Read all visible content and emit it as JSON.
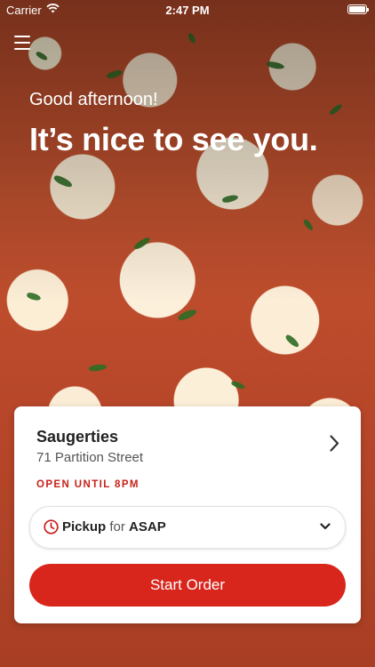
{
  "status_bar": {
    "carrier": "Carrier",
    "time": "2:47 PM"
  },
  "header": {
    "greeting": "Good afternoon!",
    "headline": "It’s nice to see you."
  },
  "location": {
    "name": "Saugerties",
    "address": "71 Partition Street",
    "hours_status": "OPEN UNTIL 8PM"
  },
  "order": {
    "method": "Pickup",
    "connector": "for",
    "time": "ASAP",
    "start_label": "Start Order"
  },
  "colors": {
    "accent": "#d9261c",
    "status_red": "#c8211a"
  },
  "icons": [
    "wifi-icon",
    "battery-icon",
    "menu-icon",
    "chevron-right-icon",
    "clock-icon",
    "chevron-down-icon"
  ]
}
